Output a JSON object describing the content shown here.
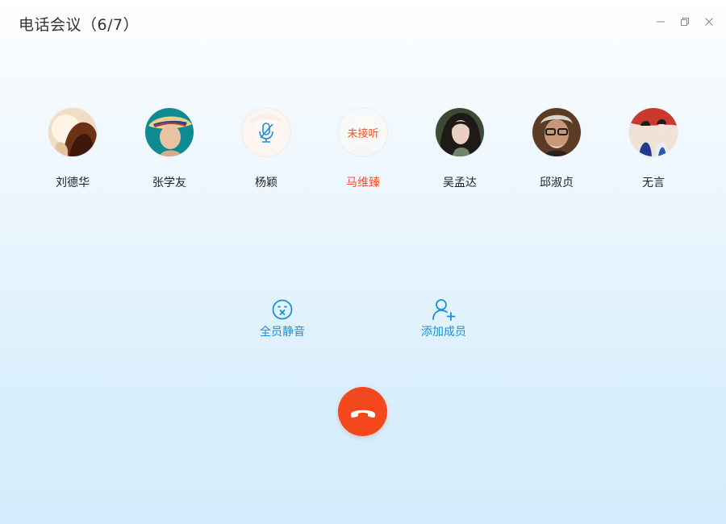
{
  "window": {
    "title": "电话会议（6/7）",
    "controls": [
      "minimize-icon",
      "restore-icon",
      "close-icon"
    ]
  },
  "participants": [
    {
      "name": "刘德华",
      "status": "connected"
    },
    {
      "name": "张学友",
      "status": "connected"
    },
    {
      "name": "杨颖",
      "status": "muted",
      "icon": "microphone-muted-icon"
    },
    {
      "name": "马维臻",
      "status": "missed",
      "badge": "未接听",
      "name_color": "#f0522e"
    },
    {
      "name": "吴孟达",
      "status": "connected"
    },
    {
      "name": "邱淑贞",
      "status": "connected"
    },
    {
      "name": "无言",
      "status": "connected"
    }
  ],
  "actions": {
    "mute_all": {
      "label": "全员静音",
      "icon": "mute-all-icon"
    },
    "add_member": {
      "label": "添加成员",
      "icon": "add-user-icon"
    }
  },
  "hangup": {
    "icon": "hang-up-phone-icon",
    "color": "#f3481e"
  },
  "colors": {
    "accent": "#1a90d8",
    "danger": "#f0522e"
  }
}
